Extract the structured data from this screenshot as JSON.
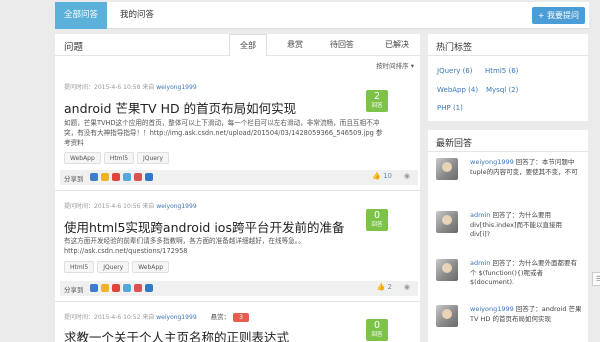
{
  "nav": {
    "all_questions": "全部问答",
    "my_questions": "我的问答",
    "ask_button": "+ 我要提问"
  },
  "main": {
    "title": "问题",
    "filter_tabs": [
      "全部",
      "悬赏",
      "待回答",
      "已解决"
    ],
    "sort_label": "按时间排序"
  },
  "questions": [
    {
      "meta_prefix": "提问时间：2015-4-6 10:58 来自",
      "user": "weiyong1999",
      "title": "android 芒果TV HD 的首页布局如何实现",
      "excerpt": "如题，芒果TVHD这个应用的首页，整体可以上下滑动，每一个栏目可以左右滑动，非常流畅，而且互相不冲突，有没有大神指导指导！！http://img.ask.csdn.net/upload/201504/03/1428059366_546509.jpg 参考资料",
      "tags": [
        "WebApp",
        "Html5",
        "JQuery"
      ],
      "answers": "2",
      "answers_label": "回答",
      "share_label": "分享到",
      "likes": "10"
    },
    {
      "meta_prefix": "提问时间：2015-4-6 10:56 来自",
      "user": "weiyong1999",
      "title": "使用html5实现跨android ios跨平台开发前的准备",
      "excerpt": "有这方面开发经验的前辈们请多多指教啊，各方面的准备越详细越好，在线等急。。http://ask.csdn.net/questions/172958",
      "tags": [
        "Html5",
        "JQuery",
        "WebApp"
      ],
      "answers": "0",
      "answers_label": "回答",
      "share_label": "分享到",
      "likes": "2"
    },
    {
      "meta_prefix": "提问时间：2015-4-6 10:52 来自",
      "user": "weiyong1999",
      "bounty_label": "悬赏：",
      "bounty": "3",
      "title": "求教一个关于个人主页名称的正则表达式",
      "answers": "0",
      "answers_label": "回答"
    }
  ],
  "hot_tags": {
    "title": "热门标签",
    "items": [
      {
        "name": "JQuery",
        "count": "(6)"
      },
      {
        "name": "Html5",
        "count": "(6)"
      },
      {
        "name": "WebApp",
        "count": "(4)"
      },
      {
        "name": "Mysql",
        "count": "(2)"
      },
      {
        "name": "PHP",
        "count": "(1)"
      }
    ]
  },
  "latest": {
    "title": "最新回答",
    "items": [
      {
        "user": "weiyong1999",
        "action": " 回答了：",
        "text": "本节问题中tuple的内容可变，要使其不变，不可"
      },
      {
        "user": "admin",
        "action": " 回答了：为什么要用div[this.index]而不能以直接用div[i]?",
        "text": ""
      },
      {
        "user": "admin",
        "action": " 回答了：为什么要外面都要有个 $(function(){)呢或者 $(document).",
        "text": ""
      },
      {
        "user": "weiyong1999",
        "action": " 回答了：android 芒果TV HD 的首页布局如何实现",
        "text": ""
      }
    ]
  },
  "float_button": "☰"
}
